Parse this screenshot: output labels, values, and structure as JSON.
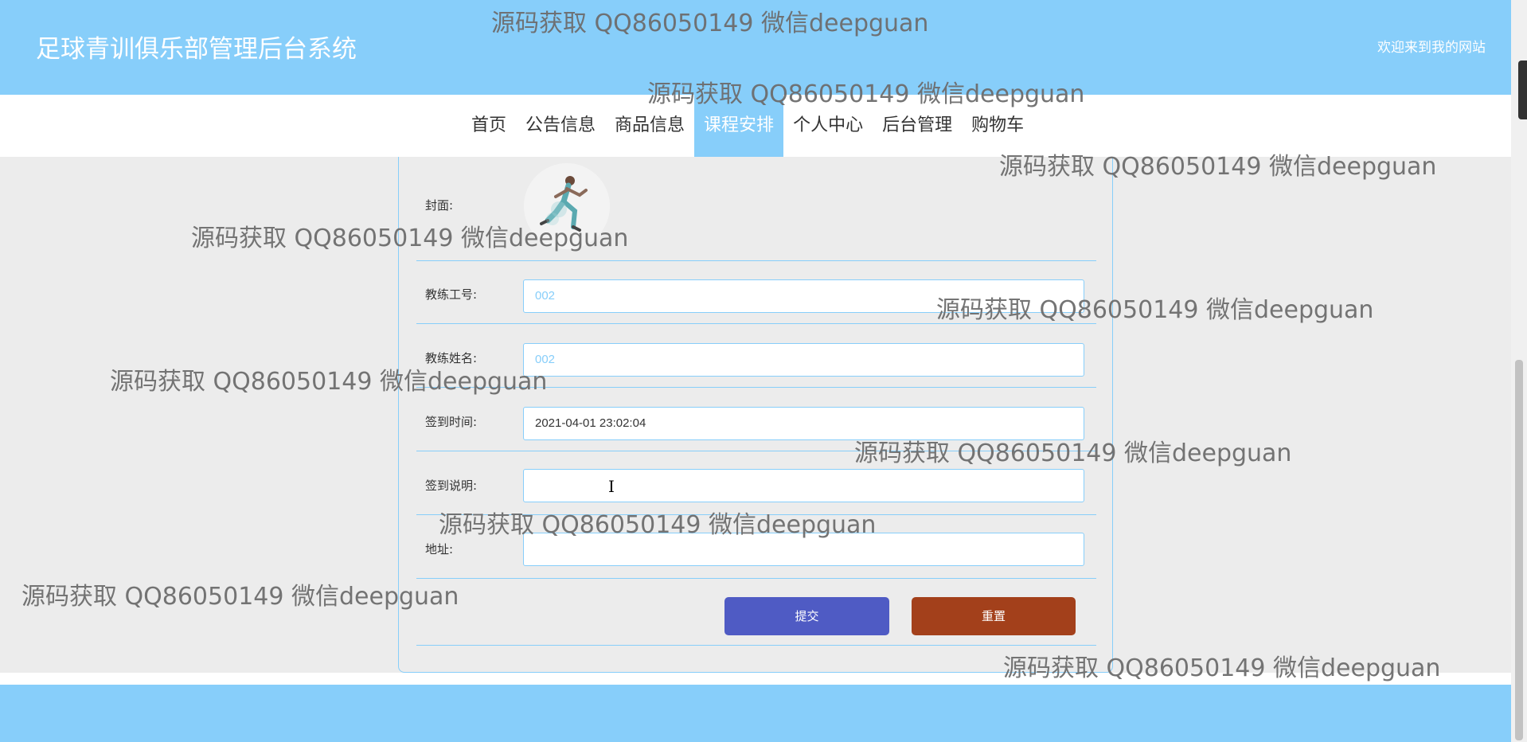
{
  "header": {
    "title": "足球青训俱乐部管理后台系统",
    "welcome": "欢迎来到我的网站"
  },
  "nav": {
    "items": [
      {
        "label": "首页"
      },
      {
        "label": "公告信息"
      },
      {
        "label": "商品信息"
      },
      {
        "label": "课程安排",
        "active": true
      },
      {
        "label": "个人中心"
      },
      {
        "label": "后台管理"
      },
      {
        "label": "购物车"
      }
    ]
  },
  "form": {
    "cover_label": "封面:",
    "coach_id_label": "教练工号:",
    "coach_id_value": "002",
    "coach_name_label": "教练姓名:",
    "coach_name_value": "002",
    "signin_time_label": "签到时间:",
    "signin_time_value": "2021-04-01 23:02:04",
    "signin_desc_label": "签到说明:",
    "signin_desc_value": "",
    "address_label": "地址:",
    "address_value": "",
    "submit_label": "提交",
    "reset_label": "重置"
  },
  "watermark": "源码获取 QQ86050149 微信deepguan",
  "colors": {
    "primary": "#87cefa",
    "submit": "#4f5bc4",
    "reset": "#a3401b",
    "background": "#ececec"
  }
}
